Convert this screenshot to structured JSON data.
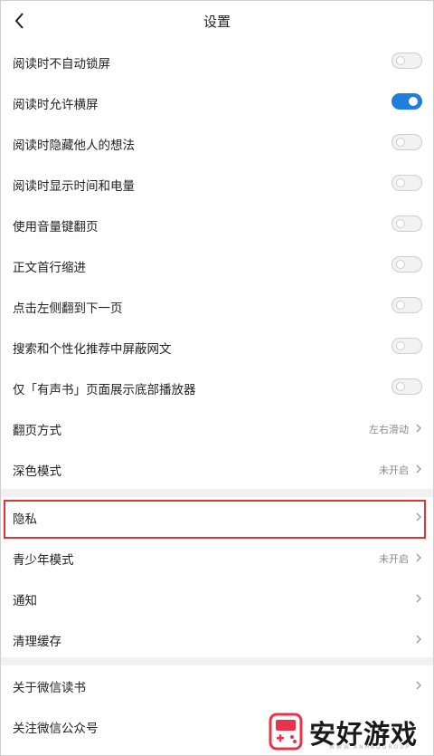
{
  "header": {
    "title": "设置"
  },
  "toggle_rows": [
    {
      "label": "阅读时不自动锁屏",
      "on": false
    },
    {
      "label": "阅读时允许横屏",
      "on": true
    },
    {
      "label": "阅读时隐藏他人的想法",
      "on": false
    },
    {
      "label": "阅读时显示时间和电量",
      "on": false
    },
    {
      "label": "使用音量键翻页",
      "on": false
    },
    {
      "label": "正文首行缩进",
      "on": false
    },
    {
      "label": "点击左侧翻到下一页",
      "on": false
    },
    {
      "label": "搜索和个性化推荐中屏蔽网文",
      "on": false
    },
    {
      "label": "仅「有声书」页面展示底部播放器",
      "on": false
    }
  ],
  "page_turn": {
    "label": "翻页方式",
    "value": "左右滑动"
  },
  "dark_mode": {
    "label": "深色模式",
    "value": "未开启"
  },
  "privacy": {
    "label": "隐私"
  },
  "teen_mode": {
    "label": "青少年模式",
    "value": "未开启"
  },
  "notifications": {
    "label": "通知"
  },
  "clear_cache": {
    "label": "清理缓存"
  },
  "about": {
    "label": "关于微信读书"
  },
  "follow": {
    "label": "关注微信公众号"
  },
  "watermark": {
    "brand": "安好游戏",
    "sub": "WWW.ANHAOGROUP"
  },
  "colors": {
    "accent": "#1e7fdd",
    "highlight_box": "#e23434",
    "divider": "#f1f1f1"
  }
}
